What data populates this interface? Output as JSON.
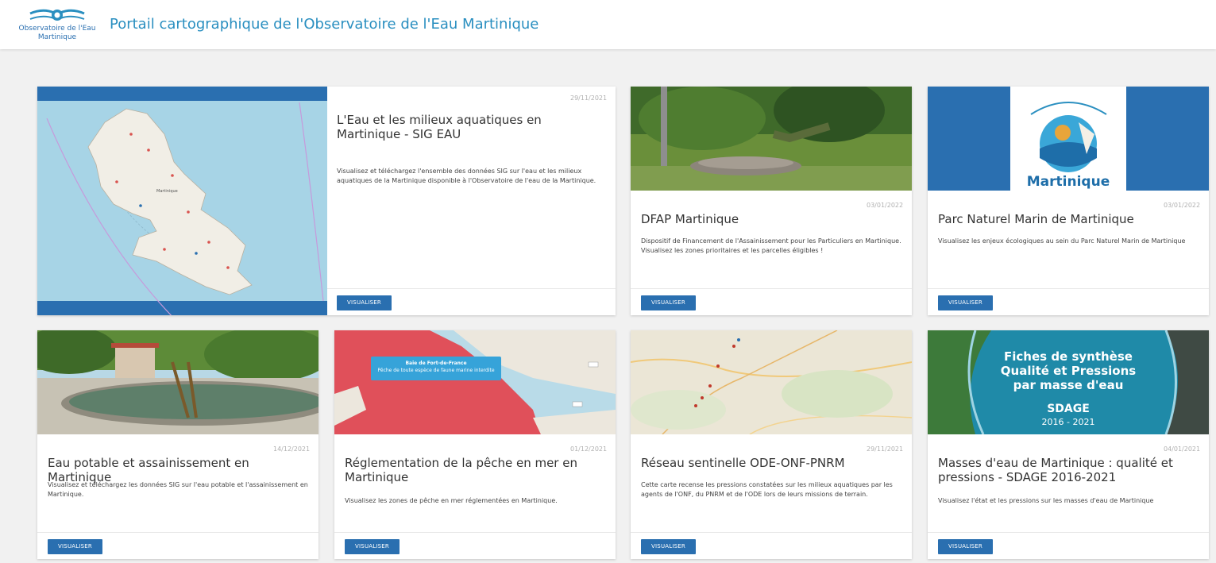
{
  "header": {
    "logo_line1": "Observatoire de l'Eau",
    "logo_line2": "Martinique",
    "title": "Portail cartographique de l'Observatoire de l'Eau Martinique"
  },
  "colors": {
    "accent": "#2a6fb0",
    "title": "#2a8fc0",
    "background": "#f1f1f1"
  },
  "cards": [
    {
      "date": "29/11/2021",
      "title": "L'Eau et les milieux aquatiques en Martinique - SIG EAU",
      "description": "Visualisez et téléchargez l'ensemble des données SIG sur l'eau et les milieux aquatiques de la Martinique disponible à l'Observatoire de l'eau de la Martinique.",
      "button": "VISUALISER",
      "image_labels": [
        "Martinique"
      ]
    },
    {
      "date": "03/01/2022",
      "title": "DFAP Martinique",
      "description": "Dispositif de Financement de l'Assainissement pour les Particuliers en Martinique. Visualisez les zones prioritaires et les parcelles éligibles !",
      "button": "VISUALISER"
    },
    {
      "date": "03/01/2022",
      "title": "Parc Naturel Marin de Martinique",
      "description": "Visualisez les enjeux écologiques au sein du Parc Naturel Marin de Martinique",
      "button": "VISUALISER",
      "image_labels": [
        "Martinique"
      ]
    },
    {
      "date": "14/12/2021",
      "title": "Eau potable et assainissement en Martinique",
      "description": "Visualisez et téléchargez les données SIG sur l'eau potable et l'assainissement en Martinique.",
      "button": "VISUALISER"
    },
    {
      "date": "01/12/2021",
      "title": "Réglementation de la pêche en mer en Martinique",
      "description": "Visualisez les zones de pêche en mer réglementées en Martinique.",
      "button": "VISUALISER",
      "image_labels": [
        "Baie de Fort-de-France",
        "Pêche de toute espèce de faune marine interdite"
      ]
    },
    {
      "date": "29/11/2021",
      "title": "Réseau sentinelle ODE-ONF-PNRM",
      "description": "Cette carte recense les pressions constatées sur les milieux aquatiques par les agents de l'ONF, du PNRM et de l'ODE lors de leurs missions de terrain.",
      "button": "VISUALISER"
    },
    {
      "date": "04/01/2021",
      "title": "Masses d'eau de Martinique : qualité et pressions - SDAGE 2016-2021",
      "description": "Visualisez l'état et les pressions sur les masses d'eau de Martinique",
      "button": "VISUALISER",
      "image_labels": [
        "Fiches de synthèse",
        "Qualité et Pressions",
        "par masse d'eau",
        "SDAGE",
        "2016 - 2021"
      ]
    }
  ]
}
